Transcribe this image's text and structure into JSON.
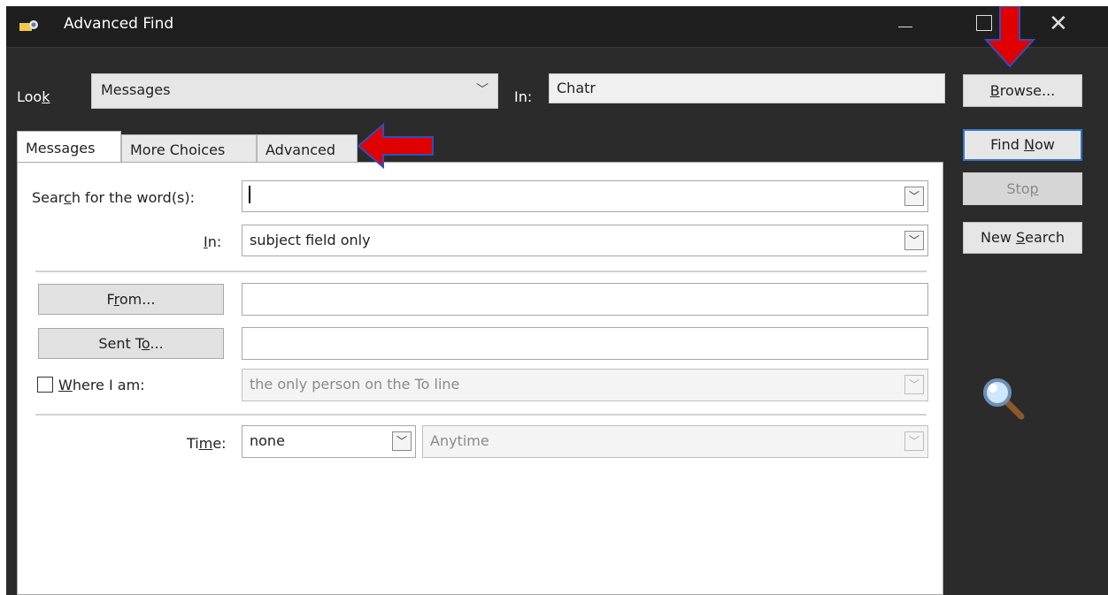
{
  "window": {
    "title": "Advanced Find",
    "close_glyph": "✕"
  },
  "search_scope": {
    "look_label_pre": "Loo",
    "look_label_key": "k",
    "look_value": "Messages",
    "in_label": "In:",
    "in_value": "Chatr",
    "browse_key": "B",
    "browse_rest": "rowse..."
  },
  "tabs": [
    {
      "label": "Messages"
    },
    {
      "label": "More Choices"
    },
    {
      "label": "Advanced"
    }
  ],
  "actions": {
    "find_now_pre": "Find ",
    "find_now_key": "N",
    "find_now_post": "ow",
    "stop_pre": "Sto",
    "stop_key": "p",
    "new_search_pre": "New ",
    "new_search_key": "S",
    "new_search_post": "earch"
  },
  "messages_tab": {
    "search_label_pre": "Sear",
    "search_label_key": "c",
    "search_label_post": "h for the word(s):",
    "search_value": "",
    "in_label_key": "I",
    "in_label_post": "n:",
    "in_value": "subject field only",
    "from_pre": "F",
    "from_key": "r",
    "from_post": "om...",
    "from_value": "",
    "sent_to_pre": "Sent T",
    "sent_to_key": "o",
    "sent_to_post": "...",
    "sent_to_value": "",
    "where_key": "W",
    "where_post": "here I am:",
    "where_checked": false,
    "where_value": "the only person on the To line",
    "time_pre": "Ti",
    "time_key": "m",
    "time_post": "e:",
    "time_value": "none",
    "time_range_value": "Anytime"
  },
  "icons": {
    "app": "binoculars-envelope-icon",
    "chevron": "chevron-down-icon",
    "magnifier": "magnifier-icon",
    "annotation_arrow_down": "red-arrow-down-icon",
    "annotation_arrow_left": "red-arrow-left-icon"
  },
  "colors": {
    "window_bg": "#2b2b2b",
    "accent_focus": "#2f78c8",
    "annotation_red": "#e00000"
  }
}
